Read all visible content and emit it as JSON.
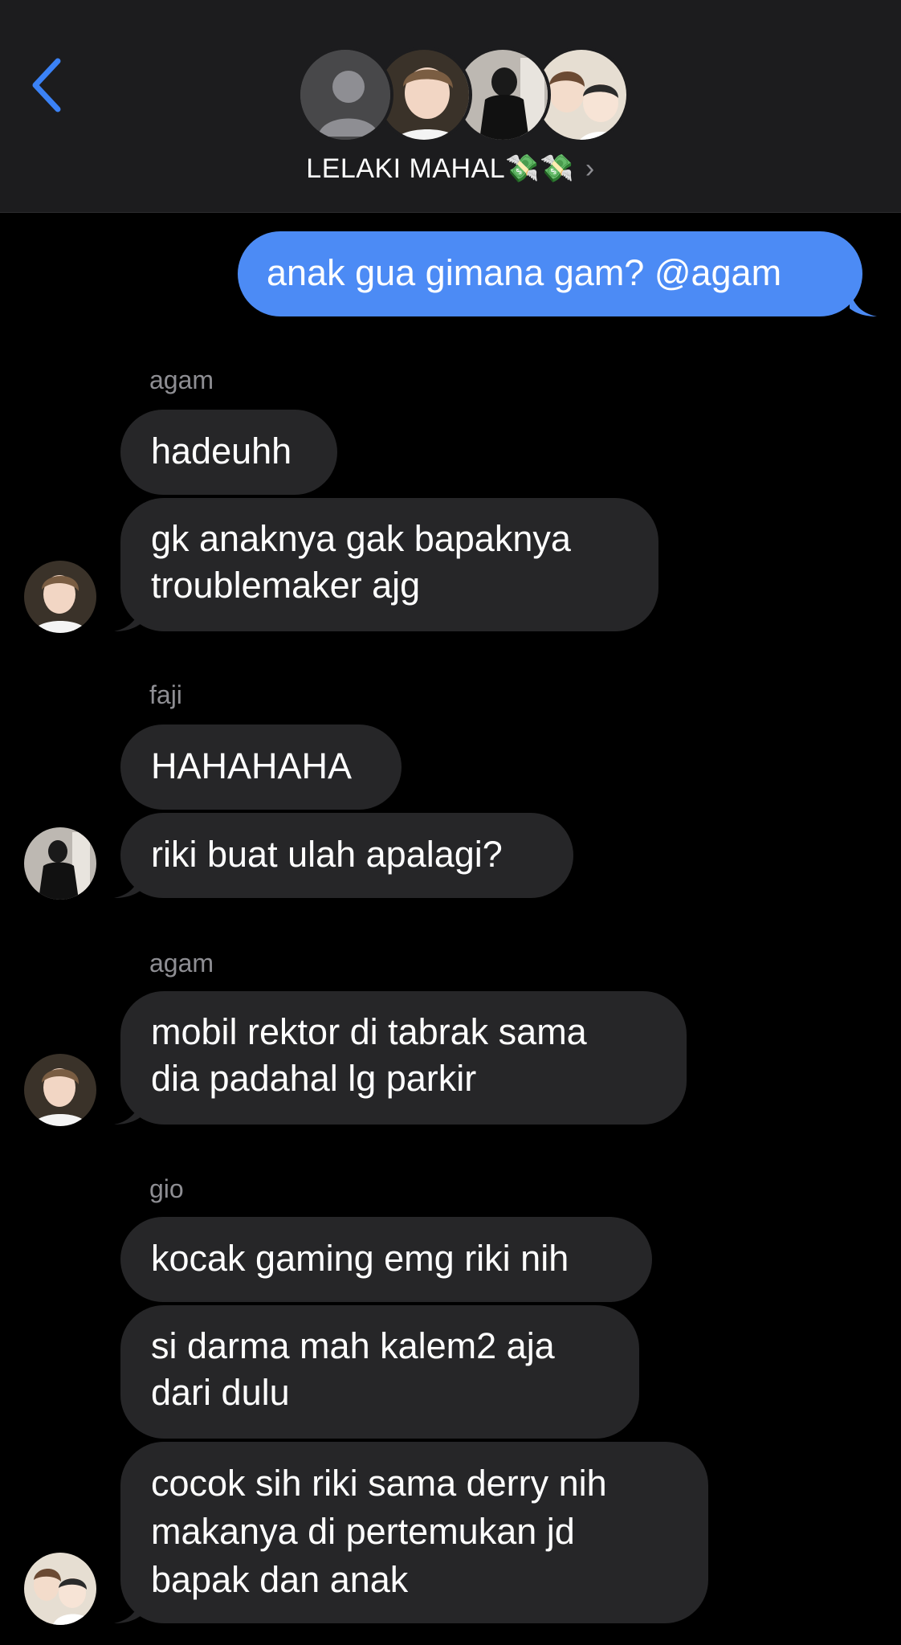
{
  "header": {
    "title": "LELAKI MAHAL",
    "title_emoji": "💸💸",
    "back_icon": "chevron-left-icon",
    "accent": "#3b82f6"
  },
  "messages": {
    "out1": "anak gua gimana gam? @agam",
    "sender1": "agam",
    "m1": "hadeuhh",
    "m2a": "gk anaknya gak bapaknya",
    "m2b": "troublemaker ajg",
    "sender2": "faji",
    "m3": "HAHAHAHA",
    "m4": "riki buat ulah apalagi?",
    "sender3": "agam",
    "m5a": "mobil rektor di tabrak sama",
    "m5b": "dia padahal lg parkir",
    "sender4": "gio",
    "m6": "kocak gaming emg riki nih",
    "m7a": "si darma mah kalem2 aja",
    "m7b": "dari dulu",
    "m8a": "cocok sih riki sama derry nih",
    "m8b": "makanya di pertemukan jd",
    "m8c": "bapak dan anak"
  },
  "colors": {
    "incoming_bubble": "#262628",
    "outgoing_bubble": "#4c8bf5",
    "header_bg": "#1c1c1e"
  }
}
